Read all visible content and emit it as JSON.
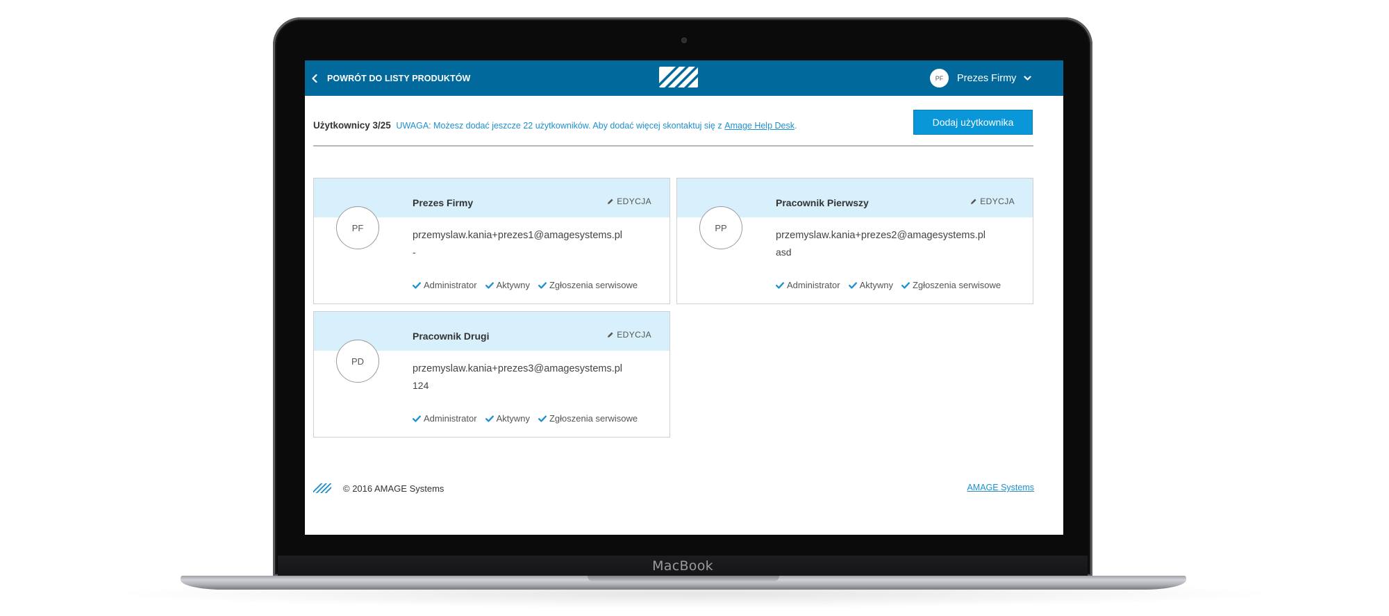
{
  "device": {
    "label": "MacBook"
  },
  "header": {
    "back_label": "POWRÓT DO LISTY PRODUKTÓW",
    "user_initials": "PF",
    "user_name": "Prezes Firmy"
  },
  "toolbar": {
    "users_count": "Użytkownicy 3/25",
    "warning": "UWAGA: Możesz dodać jeszcze 22 użytkowników. Aby dodać więcej skontaktuj się z",
    "help_link": "Amage Help Desk",
    "period": ".",
    "add_user_label": "Dodaj użytkownika"
  },
  "users": [
    {
      "initials": "PF",
      "name": "Prezes Firmy",
      "edit_label": "EDYCJA",
      "email": "przemyslaw.kania+prezes1@amagesystems.pl",
      "phone": "-",
      "badges": [
        "Administrator",
        "Aktywny",
        "Zgłoszenia serwisowe"
      ]
    },
    {
      "initials": "PP",
      "name": "Pracownik Pierwszy",
      "edit_label": "EDYCJA",
      "email": "przemyslaw.kania+prezes2@amagesystems.pl",
      "phone": "asd",
      "badges": [
        "Administrator",
        "Aktywny",
        "Zgłoszenia serwisowe"
      ]
    },
    {
      "initials": "PD",
      "name": "Pracownik Drugi",
      "edit_label": "EDYCJA",
      "email": "przemyslaw.kania+prezes3@amagesystems.pl",
      "phone": "124",
      "badges": [
        "Administrator",
        "Aktywny",
        "Zgłoszenia serwisowe"
      ]
    }
  ],
  "footer": {
    "copyright": "© 2016 AMAGE Systems",
    "link": "AMAGE Systems"
  },
  "colors": {
    "header_bg": "#02699c",
    "accent": "#0a97d9",
    "card_head_bg": "#d7f0fb",
    "check": "#1d8fd0"
  }
}
